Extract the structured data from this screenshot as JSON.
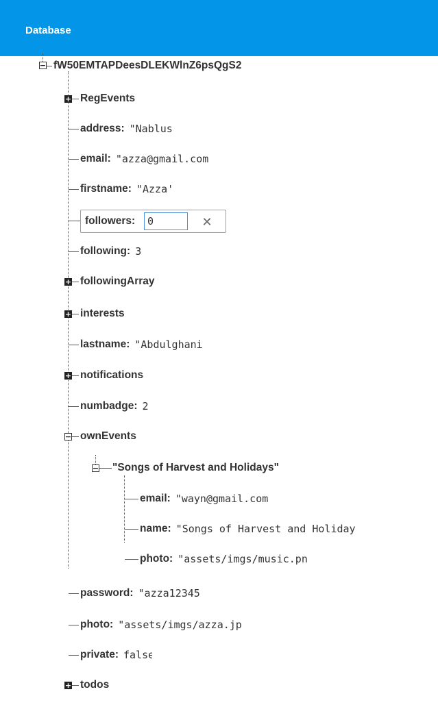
{
  "header": {
    "title": "Database"
  },
  "root": {
    "key": "fW50EMTAPDeesDLEKWlnZ6psQgS2"
  },
  "nodes": {
    "reg_events": {
      "key": "RegEvents"
    },
    "address": {
      "key": "address",
      "value": "\"Nablus"
    },
    "email": {
      "key": "email",
      "value": "\"azza@gmail.com"
    },
    "firstname": {
      "key": "firstname",
      "value": "\"Azza'"
    },
    "followers": {
      "key": "followers:",
      "value": "0"
    },
    "following": {
      "key": "following",
      "value": "3"
    },
    "following_array": {
      "key": "followingArray"
    },
    "interests": {
      "key": "interests"
    },
    "lastname": {
      "key": "lastname",
      "value": "\"Abdulghani"
    },
    "notifications": {
      "key": "notifications"
    },
    "numbadge": {
      "key": "numbadge",
      "value": "2"
    },
    "own_events": {
      "key": "ownEvents"
    },
    "own_event_item": {
      "key": "\"Songs of Harvest and Holidays\""
    },
    "oe_email": {
      "key": "email",
      "value": "\"wayn@gmail.com"
    },
    "oe_name": {
      "key": "name",
      "value": "\"Songs of Harvest and Holiday"
    },
    "oe_photo": {
      "key": "photo",
      "value": "\"assets/imgs/music.pn"
    },
    "password": {
      "key": "password",
      "value": "\"azza12345"
    },
    "photo": {
      "key": "photo",
      "value": "\"assets/imgs/azza.jp"
    },
    "private": {
      "key": "private",
      "value": "false"
    },
    "todos": {
      "key": "todos"
    }
  },
  "icons": {
    "expand": "plus-box-icon",
    "collapse": "minus-box-icon",
    "cancel": "close-icon"
  },
  "colors": {
    "header_bg": "#0395e8",
    "header_text": "#ffffff",
    "text": "#333333",
    "input_border": "#4a90d9"
  }
}
